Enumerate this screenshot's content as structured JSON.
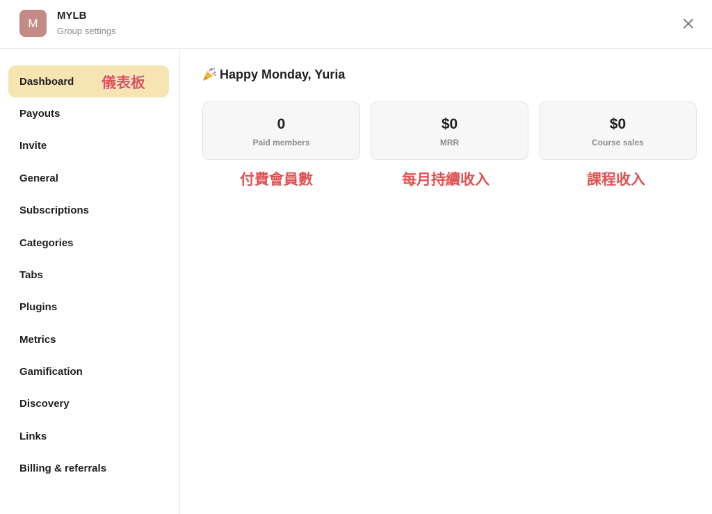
{
  "header": {
    "avatar_letter": "M",
    "group_name": "MYLB",
    "group_subtitle": "Group settings",
    "close_icon": "close-icon"
  },
  "sidebar": {
    "items": [
      {
        "label": "Dashboard",
        "active": true
      },
      {
        "label": "Payouts"
      },
      {
        "label": "Invite"
      },
      {
        "label": "General"
      },
      {
        "label": "Subscriptions"
      },
      {
        "label": "Categories"
      },
      {
        "label": "Tabs"
      },
      {
        "label": "Plugins"
      },
      {
        "label": "Metrics"
      },
      {
        "label": "Gamification"
      },
      {
        "label": "Discovery"
      },
      {
        "label": "Links"
      },
      {
        "label": "Billing & referrals"
      }
    ]
  },
  "main": {
    "greeting_icon": "party-popper-icon",
    "greeting": "Happy Monday, Yuria",
    "stats": [
      {
        "value": "0",
        "label": "Paid members"
      },
      {
        "value": "$0",
        "label": "MRR"
      },
      {
        "value": "$0",
        "label": "Course sales"
      }
    ]
  },
  "annotations": {
    "dashboard": "儀表板",
    "paid_members": "付費會員數",
    "mrr": "每月持續收入",
    "course_sales": "課程收入"
  },
  "colors": {
    "accent_active": "#f7e4b3",
    "avatar_bg": "#c48b86",
    "annotation_red": "#e05252"
  }
}
